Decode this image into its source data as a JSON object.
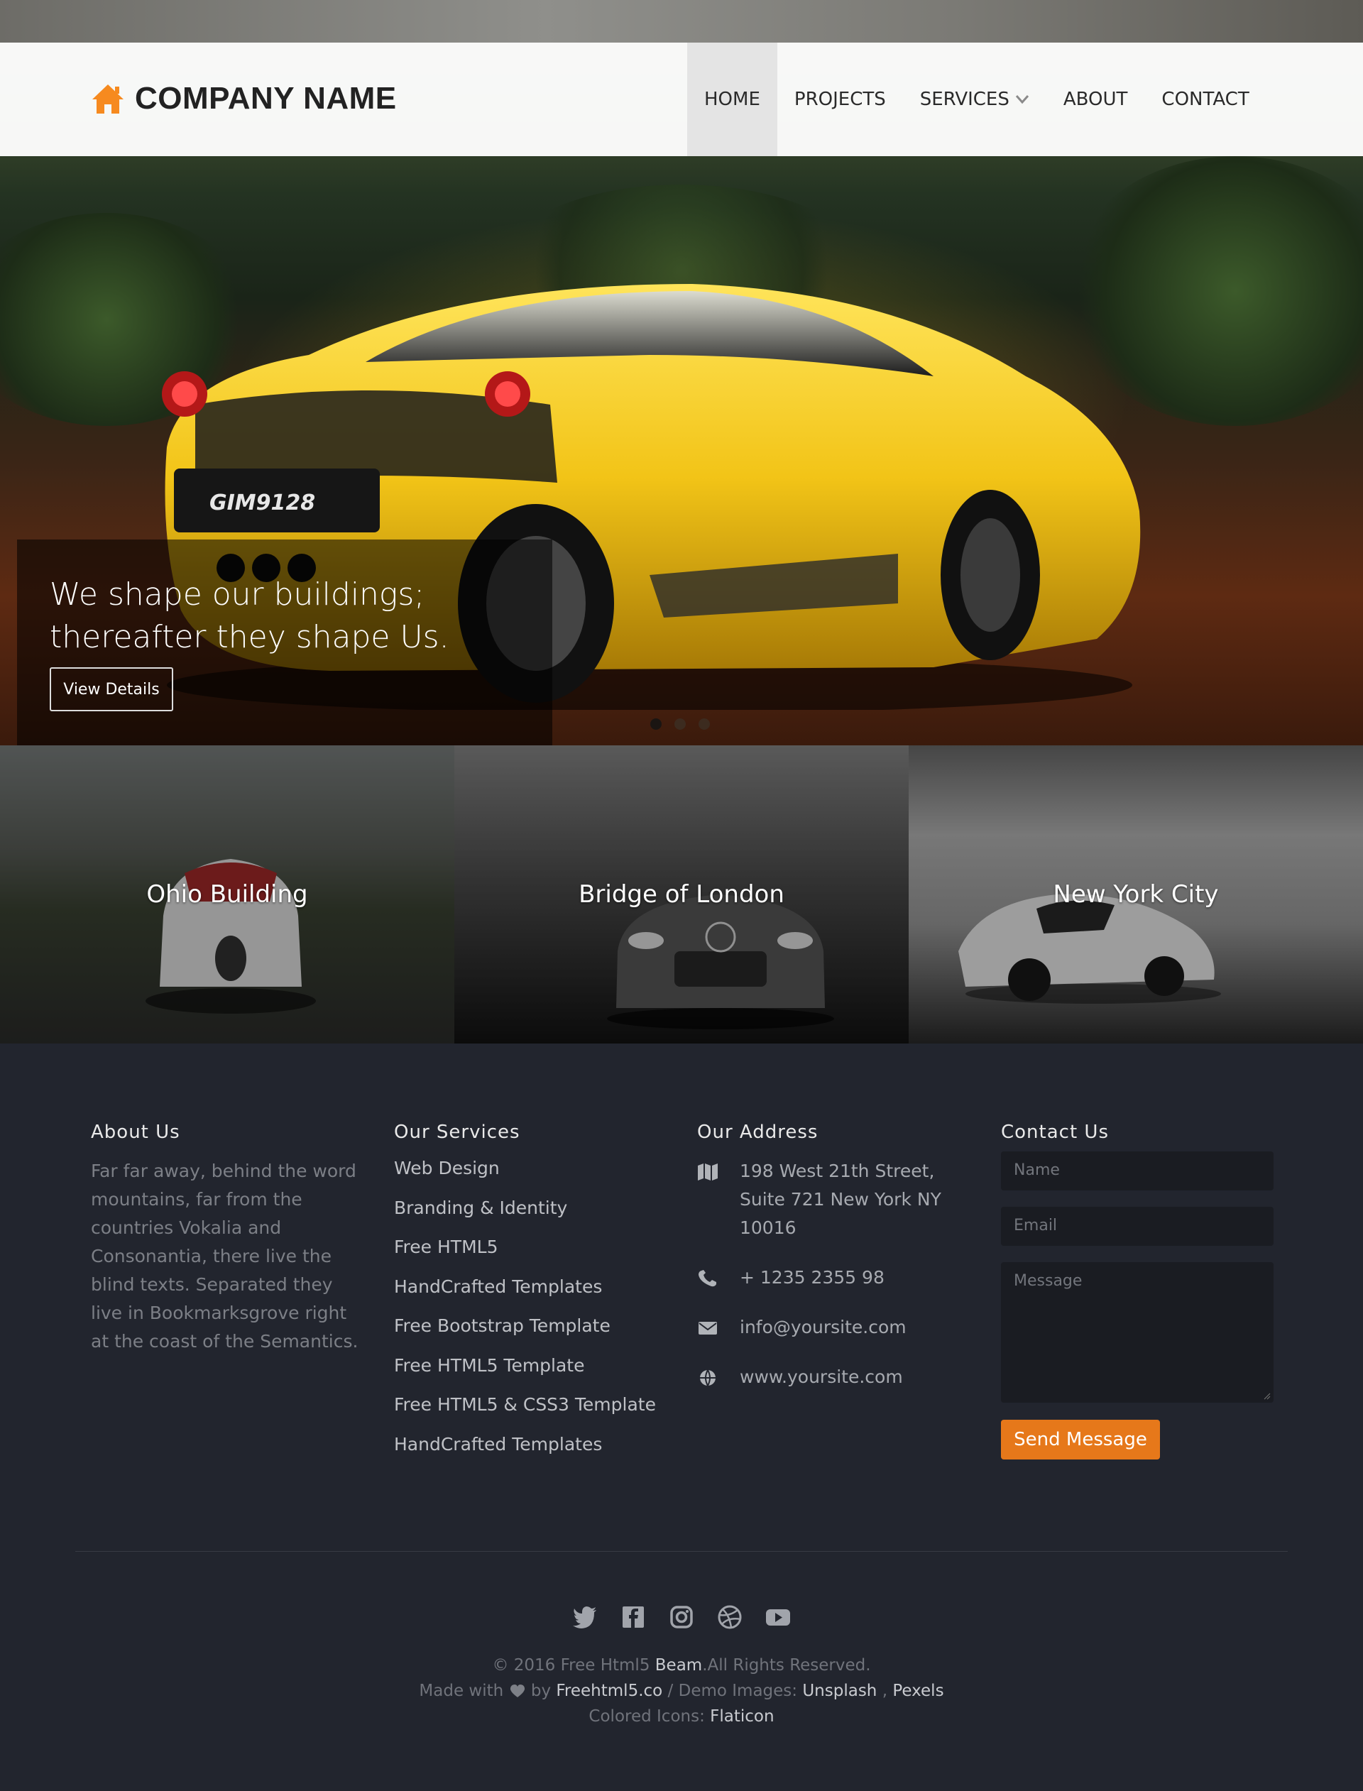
{
  "brand": {
    "name": "COMPANY NAME",
    "icon": "home-icon",
    "accent": "#f68a1f"
  },
  "nav": {
    "items": [
      {
        "label": "HOME",
        "active": true
      },
      {
        "label": "PROJECTS"
      },
      {
        "label": "SERVICES",
        "has_dropdown": true
      },
      {
        "label": "ABOUT"
      },
      {
        "label": "CONTACT"
      }
    ]
  },
  "hero": {
    "title": "We shape our buildings; thereafter they shape Us.",
    "button_label": "View Details",
    "plate": "GIM9128",
    "slides_count": 3,
    "active_slide": 1
  },
  "projects": [
    {
      "label": "Ohio Building"
    },
    {
      "label": "Bridge of London"
    },
    {
      "label": "New York City"
    }
  ],
  "footer": {
    "about": {
      "title": "About Us",
      "text": "Far far away, behind the word mountains, far from the countries Vokalia and Consonantia, there live the blind texts. Separated they live in Bookmarksgrove right at the coast of the Semantics."
    },
    "services": {
      "title": "Our Services",
      "items": [
        "Web Design",
        "Branding & Identity",
        "Free HTML5",
        "HandCrafted Templates",
        "Free Bootstrap Template",
        "Free HTML5 Template",
        "Free HTML5 & CSS3 Template",
        "HandCrafted Templates"
      ]
    },
    "address": {
      "title": "Our Address",
      "street": "198 West 21th Street, Suite 721 New York NY 10016",
      "phone": "+ 1235 2355 98",
      "email": "info@yoursite.com",
      "website": "www.yoursite.com"
    },
    "contact": {
      "title": "Contact Us",
      "name_placeholder": "Name",
      "email_placeholder": "Email",
      "message_placeholder": "Message",
      "send_label": "Send Message",
      "button_color": "#e6781a"
    },
    "social_icons": [
      "twitter-icon",
      "facebook-icon",
      "instagram-icon",
      "dribbble-icon",
      "youtube-icon"
    ],
    "credits": {
      "copyright_prefix": "© 2016 Free Html5",
      "copyright_brand": "Beam",
      "copyright_suffix": ".All Rights Reserved.",
      "made_with": "Made with",
      "by": "by",
      "author": "Freehtml5.co",
      "demo_images": "/ Demo Images:",
      "unsplash": "Unsplash",
      "comma": ",",
      "pexels": "Pexels",
      "colored_icons": "Colored Icons:",
      "flaticon": "Flaticon"
    }
  }
}
